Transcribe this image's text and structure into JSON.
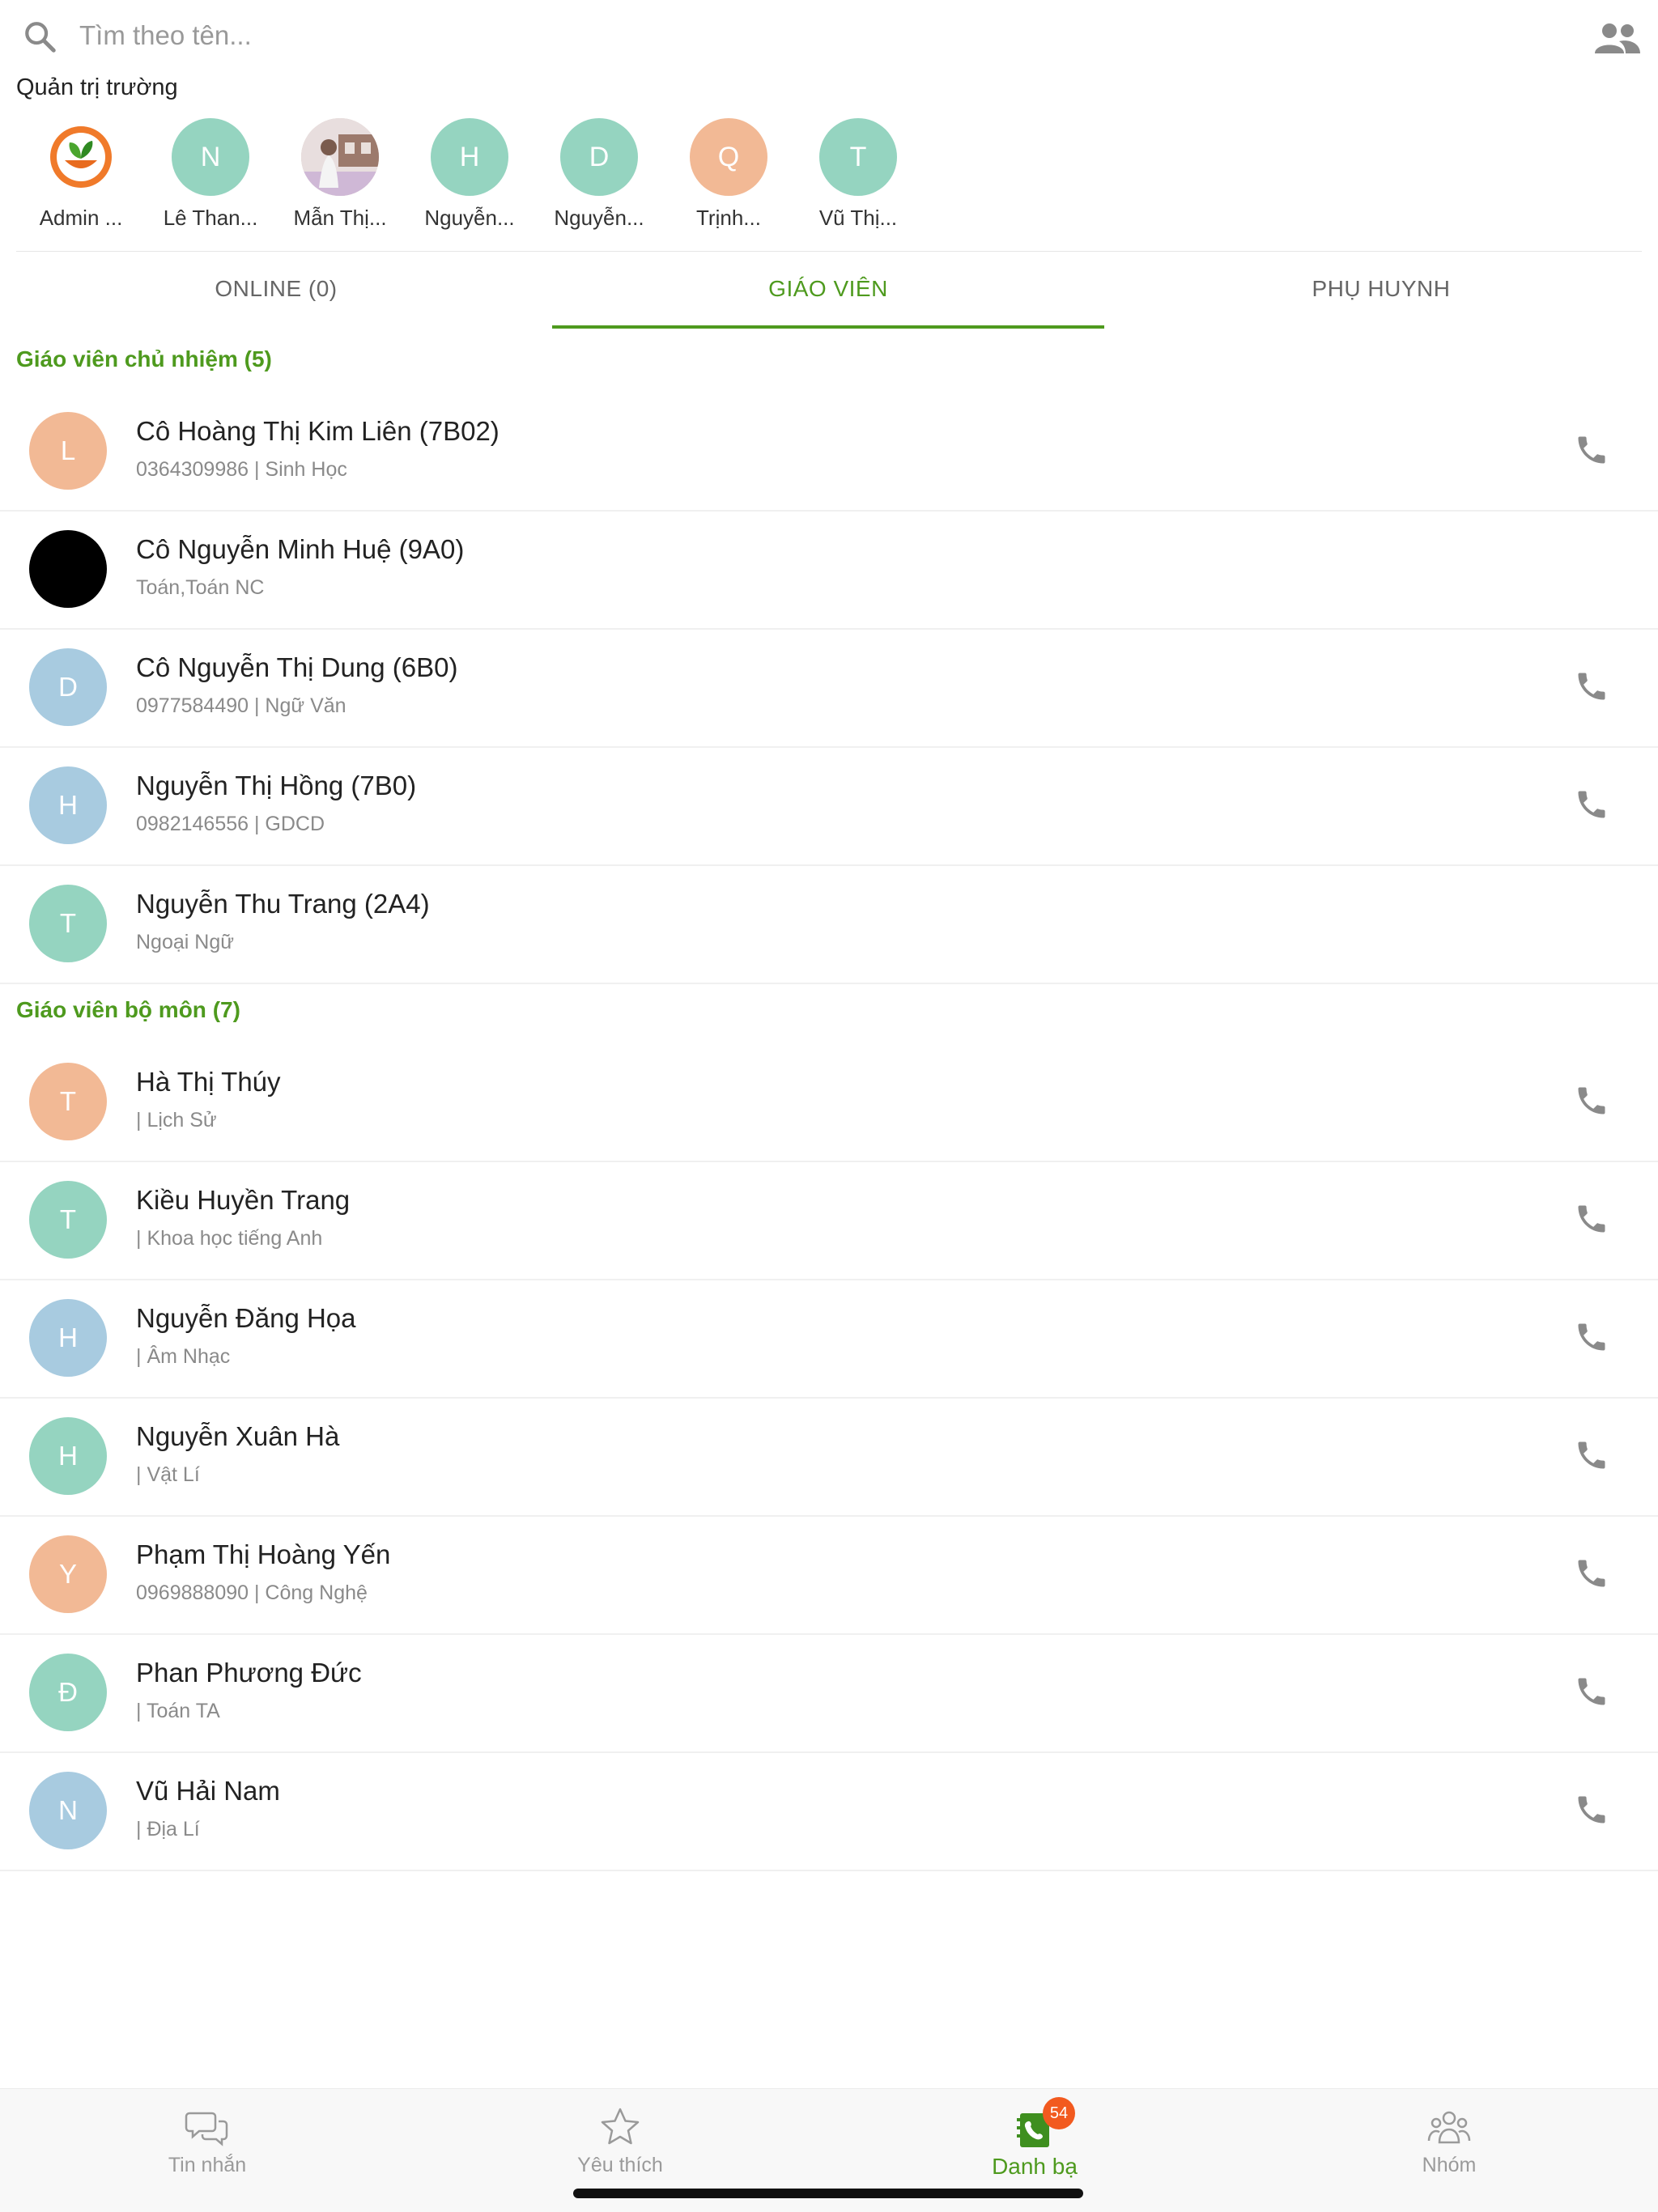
{
  "search": {
    "placeholder": "Tìm theo tên..."
  },
  "admins": {
    "title": "Quản trị trường",
    "items": [
      {
        "initial": "",
        "name": "Admin ...",
        "color": "#ffffff",
        "kind": "logo"
      },
      {
        "initial": "N",
        "name": "Lê Than...",
        "color": "#95d4c0",
        "kind": "letter"
      },
      {
        "initial": "",
        "name": "Mẫn Thị...",
        "color": "#d9c7c0",
        "kind": "photo"
      },
      {
        "initial": "H",
        "name": "Nguyễn...",
        "color": "#95d4c0",
        "kind": "letter"
      },
      {
        "initial": "D",
        "name": "Nguyễn...",
        "color": "#95d4c0",
        "kind": "letter"
      },
      {
        "initial": "Q",
        "name": "Trịnh...",
        "color": "#f2b995",
        "kind": "letter"
      },
      {
        "initial": "T",
        "name": "Vũ Thị...",
        "color": "#95d4c0",
        "kind": "letter"
      }
    ]
  },
  "tabs": [
    {
      "label": "ONLINE (0)",
      "active": false
    },
    {
      "label": "GIÁO VIÊN",
      "active": true
    },
    {
      "label": "PHỤ HUYNH",
      "active": false
    }
  ],
  "sections": [
    {
      "title": "Giáo viên chủ nhiệm (5)",
      "rows": [
        {
          "initial": "L",
          "color": "#f2b995",
          "name": "Cô Hoàng Thị Kim Liên (7B02)",
          "sub": "0364309986 | Sinh Học",
          "phone": true
        },
        {
          "initial": "",
          "color": "#000000",
          "name": "Cô Nguyễn Minh Huệ (9A0)",
          "sub": "Toán,Toán NC",
          "phone": false
        },
        {
          "initial": "D",
          "color": "#a8cbe0",
          "name": "Cô Nguyễn Thị Dung (6B0)",
          "sub": "0977584490 | Ngữ Văn",
          "phone": true
        },
        {
          "initial": "H",
          "color": "#a8cbe0",
          "name": "Nguyễn Thị Hồng (7B0)",
          "sub": "0982146556 | GDCD",
          "phone": true
        },
        {
          "initial": "T",
          "color": "#95d4c0",
          "name": "Nguyễn Thu Trang (2A4)",
          "sub": "Ngoại Ngữ",
          "phone": false
        }
      ]
    },
    {
      "title": "Giáo viên bộ môn (7)",
      "rows": [
        {
          "initial": "T",
          "color": "#f2b995",
          "name": "Hà Thị Thúy",
          "sub": " | Lịch Sử",
          "phone": true
        },
        {
          "initial": "T",
          "color": "#95d4c0",
          "name": "Kiều Huyền Trang",
          "sub": " | Khoa học tiếng Anh",
          "phone": true
        },
        {
          "initial": "H",
          "color": "#a8cbe0",
          "name": "Nguyễn Đăng Họa",
          "sub": " | Âm Nhạc",
          "phone": true
        },
        {
          "initial": "H",
          "color": "#95d4c0",
          "name": "Nguyễn Xuân Hà",
          "sub": " | Vật Lí",
          "phone": true
        },
        {
          "initial": "Y",
          "color": "#f2b995",
          "name": "Phạm Thị Hoàng Yến",
          "sub": "0969888090 | Công Nghệ",
          "phone": true
        },
        {
          "initial": "Đ",
          "color": "#95d4c0",
          "name": "Phan Phương Đức",
          "sub": " | Toán TA",
          "phone": true
        },
        {
          "initial": "N",
          "color": "#a8cbe0",
          "name": "Vũ Hải Nam",
          "sub": " | Địa Lí",
          "phone": true
        }
      ]
    }
  ],
  "bottom_nav": [
    {
      "label": "Tin nhắn",
      "icon": "chat-icon",
      "active": false
    },
    {
      "label": "Yêu thích",
      "icon": "star-icon",
      "active": false
    },
    {
      "label": "Danh bạ",
      "icon": "contacts-book-icon",
      "active": true,
      "badge": "54"
    },
    {
      "label": "Nhóm",
      "icon": "group-icon",
      "active": false
    }
  ],
  "colors": {
    "accent": "#4e9a1e",
    "badge": "#f25a1f"
  }
}
